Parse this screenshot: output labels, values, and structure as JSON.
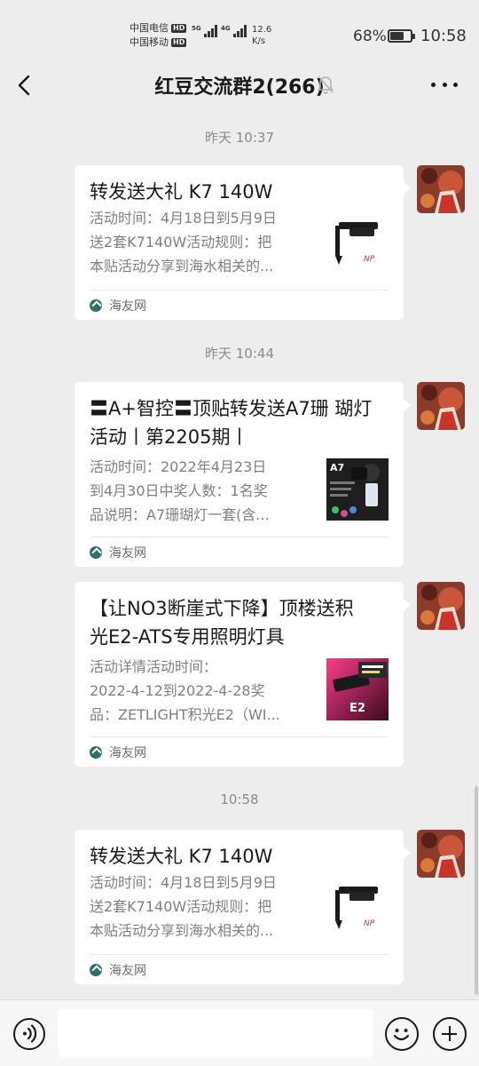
{
  "status_bar": {
    "carrier_1": "中国电信",
    "carrier_2": "中国移动",
    "hd_badge": "HD",
    "signal_tag_1": "5G",
    "signal_tag_2": "4G",
    "net_speed_value": "12.6",
    "net_speed_unit": "K/s",
    "battery_percent": "68%",
    "battery_level": 0.68,
    "time": "10:58"
  },
  "nav": {
    "title": "红豆交流群2(266)",
    "back_icon": "chevron-left-icon",
    "mute_icon": "bell-off-icon",
    "more_icon": "more-icon"
  },
  "messages": [
    {
      "timestamp": "昨天 10:37",
      "title": "转发送大礼 K7 140W",
      "desc_lines": [
        "活动时间：4月18日到5月9日",
        "送2套K7140W活动规则：把",
        "本贴活动分享到海水相关的..."
      ],
      "source": "海友网"
    },
    {
      "timestamp": "昨天 10:44",
      "title_lines": [
        "〓A+智控〓顶贴转发送A7珊 瑚灯",
        "活动丨第2205期丨"
      ],
      "desc_lines": [
        "活动时间：2022年4月23日",
        "到4月30日中奖人数：1名奖",
        "品说明：A7珊瑚灯一套(含..."
      ],
      "thumb_label": "A7",
      "source": "海友网"
    },
    {
      "title_lines": [
        "【让NO3断崖式下降】顶楼送积",
        "光E2-ATS专用照明灯具"
      ],
      "desc_lines": [
        "活动详情活动时间：",
        "2022-4-12到2022-4-28奖",
        "品：ZETLIGHT积光E2（WI..."
      ],
      "thumb_label": "E2",
      "source": "海友网"
    },
    {
      "timestamp": "10:58",
      "title": "转发送大礼 K7 140W",
      "desc_lines": [
        "活动时间：4月18日到5月9日",
        "送2套K7140W活动规则：把",
        "本贴活动分享到海水相关的..."
      ],
      "source": "海友网"
    }
  ],
  "input_bar": {
    "voice_icon": "voice-icon",
    "input_value": "",
    "emoji_icon": "emoji-icon",
    "plus_icon": "plus-icon"
  },
  "colors": {
    "background": "#ededed",
    "card": "#ffffff",
    "muted_text": "#7f7f7f",
    "avatar_red": "#b8321f"
  }
}
